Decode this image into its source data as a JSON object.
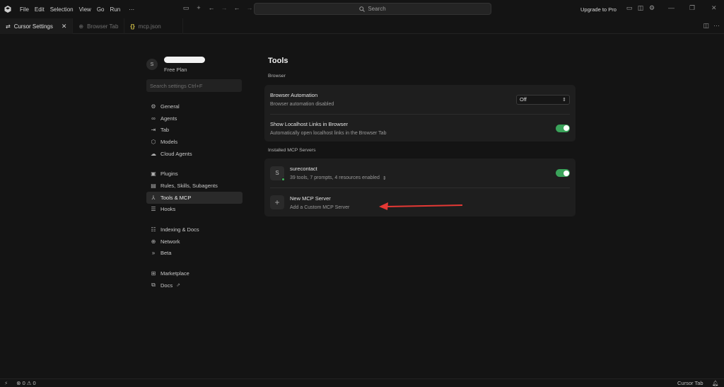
{
  "menu": [
    "File",
    "Edit",
    "Selection",
    "View",
    "Go",
    "Run",
    "···"
  ],
  "search": {
    "placeholder": "Search"
  },
  "upgrade_label": "Upgrade to Pro",
  "tabs": [
    {
      "label": "Cursor Settings",
      "icon": "settings-sliders-icon"
    },
    {
      "label": "Browser Tab",
      "icon": "globe-icon"
    },
    {
      "label": "mcp.json",
      "icon": "json-braces-icon"
    }
  ],
  "sidebar": {
    "avatar_letter": "S",
    "plan": "Free Plan",
    "search_placeholder": "Search settings Ctrl+F",
    "groups": [
      [
        {
          "label": "General",
          "icon": "gear-icon"
        },
        {
          "label": "Agents",
          "icon": "infinity-icon"
        },
        {
          "label": "Tab",
          "icon": "tab-arrow-icon"
        },
        {
          "label": "Models",
          "icon": "cube-icon"
        },
        {
          "label": "Cloud Agents",
          "icon": "cloud-icon"
        }
      ],
      [
        {
          "label": "Plugins",
          "icon": "plugin-icon"
        },
        {
          "label": "Rules, Skills, Subagents",
          "icon": "clipboard-icon"
        },
        {
          "label": "Tools & MCP",
          "icon": "tools-icon"
        },
        {
          "label": "Hooks",
          "icon": "hooks-icon"
        }
      ],
      [
        {
          "label": "Indexing & Docs",
          "icon": "database-icon"
        },
        {
          "label": "Network",
          "icon": "globe-icon"
        },
        {
          "label": "Beta",
          "icon": "chevrons-icon"
        }
      ],
      [
        {
          "label": "Marketplace",
          "icon": "grid-icon"
        },
        {
          "label": "Docs",
          "icon": "book-icon"
        }
      ]
    ]
  },
  "main": {
    "title": "Tools",
    "browser_section": "Browser",
    "browser_automation": {
      "title": "Browser Automation",
      "subtitle": "Browser automation disabled",
      "value": "Off"
    },
    "localhost_links": {
      "title": "Show Localhost Links in Browser",
      "subtitle": "Automatically open localhost links in the Browser Tab",
      "enabled": true
    },
    "mcp_section": "Installed MCP Servers",
    "servers": [
      {
        "letter": "S",
        "name": "surecontact",
        "details": "39 tools, 7 prompts, 4 resources enabled",
        "enabled": true
      }
    ],
    "new_server": {
      "title": "New MCP Server",
      "subtitle": "Add a Custom MCP Server"
    }
  },
  "statusbar": {
    "errors": "0",
    "warnings": "0",
    "right_label": "Cursor Tab"
  },
  "colors": {
    "toggle_on": "#3aa35a",
    "arrow": "#e53935",
    "background": "#141414",
    "card": "#1e1e1e"
  }
}
